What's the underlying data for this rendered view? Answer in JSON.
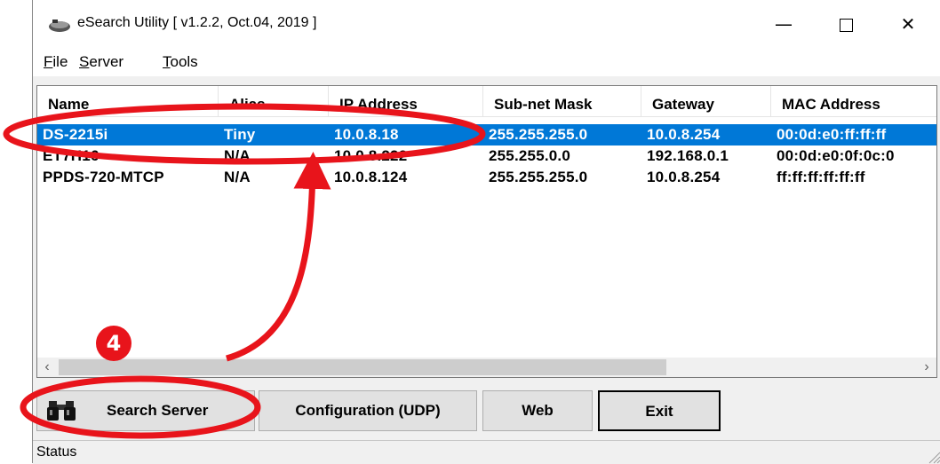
{
  "window": {
    "title": "eSearch Utility [ v1.2.2, Oct.04, 2019 ]",
    "minimize_glyph": "—",
    "close_glyph": "✕"
  },
  "menu": {
    "items": [
      {
        "acc": "F",
        "rest": "ile"
      },
      {
        "acc": "S",
        "rest": "erver"
      },
      {
        "acc": "T",
        "rest": "ools"
      }
    ]
  },
  "table": {
    "columns": [
      "Name",
      "Alias",
      "IP Address",
      "Sub-net Mask",
      "Gateway",
      "MAC Address"
    ],
    "rows": [
      {
        "name": "DS-2215i",
        "alias": "Tiny",
        "ip": "10.0.8.18",
        "mask": "255.255.255.0",
        "gateway": "10.0.8.254",
        "mac": "00:0d:e0:ff:ff:ff",
        "selected": true
      },
      {
        "name": "ET7H16",
        "alias": "N/A",
        "ip": "10.0.8.222",
        "mask": "255.255.0.0",
        "gateway": "192.168.0.1",
        "mac": "00:0d:e0:0f:0c:0",
        "selected": false
      },
      {
        "name": "PPDS-720-MTCP",
        "alias": "N/A",
        "ip": "10.0.8.124",
        "mask": "255.255.255.0",
        "gateway": "10.0.8.254",
        "mac": "ff:ff:ff:ff:ff:ff",
        "selected": false
      }
    ]
  },
  "scrollbar": {
    "left_arrow": "‹",
    "right_arrow": "›"
  },
  "buttons": {
    "search": "Search Server",
    "config": "Configuration (UDP)",
    "web": "Web",
    "exit": "Exit"
  },
  "status": {
    "text": "Status"
  },
  "annotation": {
    "step": "4",
    "color": "#e8141b"
  },
  "colors": {
    "selection": "#0078d7",
    "annotation_red": "#e8141b"
  }
}
